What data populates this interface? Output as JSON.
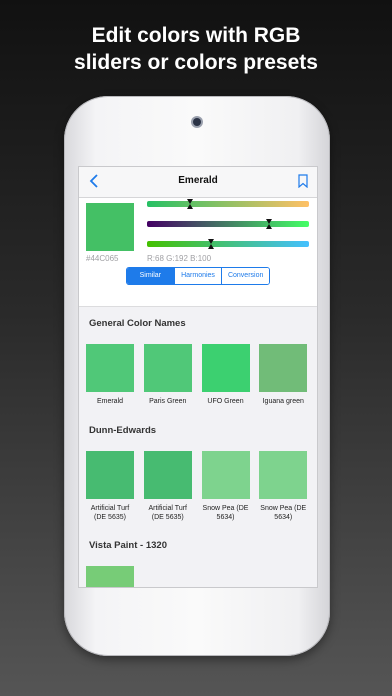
{
  "headline": {
    "line1": "Edit colors with RGB",
    "line2": "sliders or colors presets"
  },
  "navbar": {
    "title": "Emerald"
  },
  "editor": {
    "main_color": "#44C065",
    "hex_label": "#44C065",
    "rgb_label": "R:68 G:192 B:100",
    "sliders": [
      {
        "name": "red",
        "value": 68,
        "max": 255,
        "gradient": [
          "#26c064",
          "#ffc065"
        ]
      },
      {
        "name": "green",
        "value": 192,
        "max": 255,
        "gradient": [
          "#440064",
          "#44ff65"
        ]
      },
      {
        "name": "blue",
        "value": 100,
        "max": 255,
        "gradient": [
          "#44c000",
          "#44c0ff"
        ]
      }
    ],
    "tabs": [
      {
        "label": "Similar",
        "active": true
      },
      {
        "label": "Harmonies",
        "active": false
      },
      {
        "label": "Conversion",
        "active": false
      }
    ]
  },
  "sections": [
    {
      "title": "General Color Names",
      "items": [
        {
          "name": "Emerald",
          "color": "#50c878"
        },
        {
          "name": "Paris Green",
          "color": "#50c878"
        },
        {
          "name": "UFO Green",
          "color": "#3cd070"
        },
        {
          "name": "Iguana green",
          "color": "#71bc78"
        }
      ]
    },
    {
      "title": "Dunn-Edwards",
      "items": [
        {
          "name": "Artificial Turf (DE 5635)",
          "color": "#47bb71"
        },
        {
          "name": "Artificial Turf (DE 5635)",
          "color": "#47bb71"
        },
        {
          "name": "Snow Pea (DE 5634)",
          "color": "#7ed38e"
        },
        {
          "name": "Snow Pea (DE 5634)",
          "color": "#7ed38e"
        }
      ]
    },
    {
      "title": "Vista Paint - 1320",
      "items": [
        {
          "name": "",
          "color": "#77cc77"
        }
      ]
    }
  ]
}
